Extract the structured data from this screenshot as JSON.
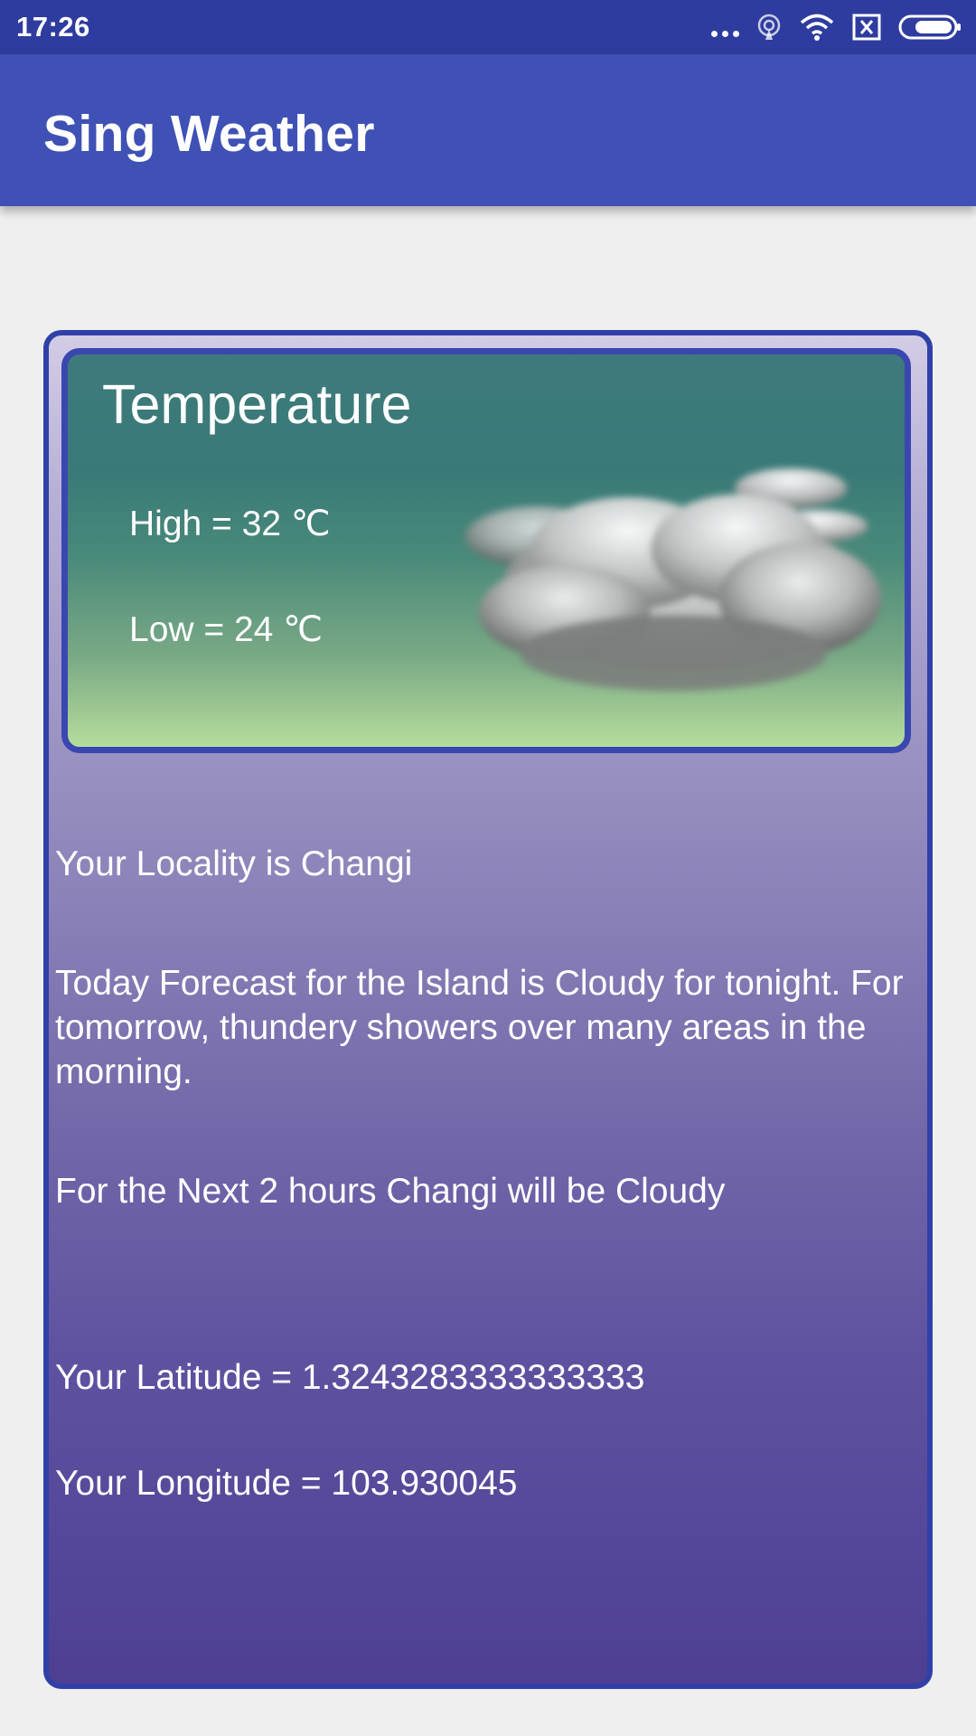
{
  "status_bar": {
    "time": "17:26",
    "icons": [
      "more-dots-icon",
      "hotspot-icon",
      "wifi-icon",
      "sim-card-x-icon",
      "battery-icon"
    ]
  },
  "app_bar": {
    "title": "Sing Weather",
    "color": "#3f51b5"
  },
  "temperature": {
    "heading": "Temperature",
    "high": "High = 32 ℃",
    "low": "Low = 24 ℃",
    "icon": "cloud-icon"
  },
  "info": {
    "locality": "Your Locality is Changi",
    "forecast": "Today Forecast for the Island is Cloudy for tonight. For tomorrow, thundery showers over many areas in the morning.",
    "next_hours": "For the Next 2 hours Changi will be Cloudy",
    "latitude": "Your Latitude = 1.3243283333333333",
    "longitude": "Your Longitude = 103.930045"
  },
  "colors": {
    "status_bar": "#2f3c9f",
    "accent": "#3f51b5",
    "card_border": "#3140a8",
    "text": "#ffffff"
  }
}
